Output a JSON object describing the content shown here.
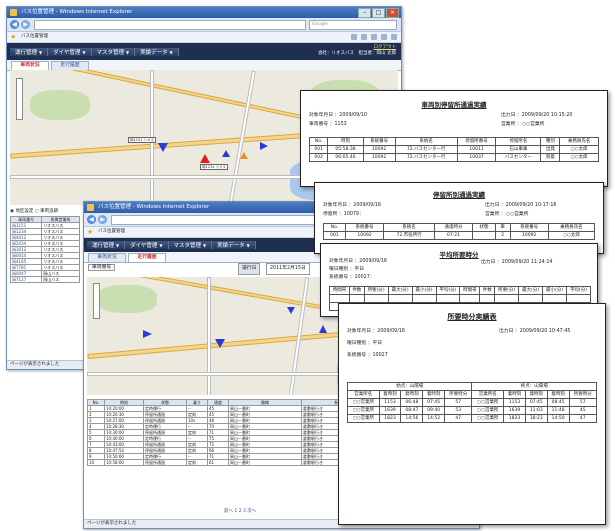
{
  "browser": {
    "title": "バス位置管理 - Windows Internet Explorer",
    "favorite_tab": "バス位置管理",
    "search_placeholder": "Google",
    "status_text": "ページが表示されました",
    "zone_text": "ローカル イントラネット",
    "zoom_text": "100%"
  },
  "app": {
    "menus": [
      "運行管理",
      "ダイヤ管理",
      "マスタ管理",
      "実績データ"
    ],
    "logout": "ログアウト",
    "user_info": "会社：リオスバス　担当者：岡山 太郎"
  },
  "back_window": {
    "tabs": [
      "車両状況",
      "走行履歴"
    ],
    "filter_label": "地区設定",
    "filter_option": "車両追跡",
    "list_headers": [
      "車両番号",
      "所属営業所",
      "所属"
    ],
    "list_rows": [
      [
        "岡1151",
        "リオスバス"
      ],
      [
        "岡1234",
        "リオスバス"
      ],
      [
        "岡4012",
        "リオスバス"
      ],
      [
        "岡2034",
        "リオスバス"
      ],
      [
        "岡3012",
        "リオスバス"
      ],
      [
        "岡0014",
        "リオスバス"
      ],
      [
        "岡4165",
        "リオスバス"
      ],
      [
        "岡7781",
        "リオスバス"
      ],
      [
        "岡0047",
        "岡山バス"
      ],
      [
        "岡7127",
        "岡山バス"
      ]
    ]
  },
  "front_window": {
    "tabs": [
      "車両状況",
      "走行履歴"
    ],
    "vehicle_field": "車両番号",
    "date_label": "運行日",
    "date_value": "2011年2月15日",
    "table_headers": [
      "No.",
      "時刻",
      "状態",
      "乗り",
      "速度",
      "路線",
      "系統"
    ],
    "rows": [
      [
        "1",
        "10:20:00",
        "定時運行",
        "--",
        "45",
        "岡山一番町",
        "倉敷駅行き"
      ],
      [
        "2",
        "10:20:30",
        "停留所通過",
        "定刻",
        "45",
        "岡山一番町",
        "倉敷駅行き"
      ],
      [
        "3",
        "10:27:00",
        "停留所通過",
        "10s",
        "48",
        "岡山一番町",
        "倉敷駅行き"
      ],
      [
        "4",
        "10:28:30",
        "定時運行",
        "--",
        "70",
        "岡山一番町",
        "倉敷駅行き"
      ],
      [
        "5",
        "10:30:00",
        "停留所通過",
        "定刻",
        "71",
        "岡山一番町",
        "倉敷駅行き"
      ],
      [
        "6",
        "10:40:00",
        "定時運行",
        "--",
        "75",
        "岡山一番町",
        "倉敷駅行き"
      ],
      [
        "7",
        "10:43:00",
        "停留所通過",
        "定刻",
        "75",
        "岡山一番町",
        "倉敷駅行き"
      ],
      [
        "8",
        "10:47:54",
        "停留所通過",
        "定刻",
        "66",
        "岡山一番町",
        "倉敷駅行き"
      ],
      [
        "9",
        "10:50:00",
        "定時運行",
        "--",
        "71",
        "岡山一番町",
        "倉敷駅行き"
      ],
      [
        "10",
        "10:58:00",
        "停留所通過",
        "定刻",
        "61",
        "岡山一番町",
        "倉敷駅行き"
      ]
    ],
    "side_notes": [
      "",
      "",
      "",
      "",
      "",
      "県病院前",
      "",
      "角前",
      "",
      "某ヶ瀬"
    ],
    "pagination": "前へ  1  2  3  次へ"
  },
  "reports": [
    {
      "title": "車両別停留所通過実績",
      "meta": [
        "対象年月日 ：2009/09/10",
        "車両番号 ：1153"
      ],
      "meta_right": [
        "出力日 ：2009/09/20 10:15:20",
        "営業所 ：○○営業所"
      ],
      "headers": [
        "No.",
        "時刻",
        "系統番号",
        "系統名",
        "停留所番号",
        "停留所名",
        "種別",
        "乗務員氏名"
      ],
      "rows": [
        [
          "001",
          "05:58:38",
          "10092",
          "72.バスセンター行",
          "10011",
          "石山車庫",
          "出発",
          "○○太郎"
        ],
        [
          "002",
          "06:05:46",
          "10092",
          "72.バスセンター行",
          "10037",
          "バスセンター",
          "到着",
          "○○太郎"
        ]
      ]
    },
    {
      "title": "停留所別通過実績",
      "meta": [
        "対象年月日 ：2009/09/16",
        "停留所 ：10079："
      ],
      "meta_right": [
        "出力日 ：2009/09/20 10:17:16",
        "営業所 ：○○営業所"
      ],
      "headers": [
        "No.",
        "系統番号",
        "系統名",
        "通過時分",
        "状態",
        "車",
        "系統番号",
        "乗務員氏名"
      ],
      "rows": [
        [
          "001",
          "10092",
          "72.市役所行",
          "07:21",
          "",
          "2",
          "10092",
          "○○太郎"
        ]
      ]
    },
    {
      "title": "平均所要時分",
      "meta": [
        "対象年月日 ：2009/09/16",
        "曜日種別 ：平日",
        "系統番号 ：10027："
      ],
      "meta_right": [
        "出力日 ：2009/09/20 11:24:14"
      ],
      "headers": [
        "時間帯",
        "件数",
        "所要(分)",
        "最大(分)",
        "最小(分)",
        "平均(分)",
        "時間帯",
        "件数",
        "所要(分)",
        "最大(分)",
        "最小(分)",
        "平均(分)"
      ]
    },
    {
      "title": "所要時分実績表",
      "meta": [
        "対象年月日 ：2009/09/16",
        "曜日種別 ：平日",
        "系統番号 ：10027"
      ],
      "meta_right": [
        "出力日 ：2009/09/20 10:47:45"
      ],
      "group_headers": [
        "始点：山陽場",
        "終点：山陽場"
      ],
      "headers": [
        "営業所名",
        "着時刻",
        "発時刻",
        "着時刻",
        "所要時分",
        "営業所名",
        "着時刻",
        "発時刻",
        "着時刻",
        "所要時分"
      ],
      "rows": [
        [
          "○○営業所",
          "1153",
          "06:48",
          "07:45",
          "57",
          "○○営業所",
          "1153",
          "07:45",
          "08:45",
          "57"
        ],
        [
          "○○営業所",
          "1639",
          "08:47",
          "09:40",
          "53",
          "○○営業所",
          "1639",
          "11:03",
          "11:48",
          "45"
        ],
        [
          "○○営業所",
          "1823",
          "14:56",
          "14:52",
          "47",
          "○○営業所",
          "1823",
          "18:23",
          "14:50",
          "47"
        ]
      ]
    }
  ],
  "colors": {
    "menubar": "#1f2f4f",
    "titlebar": "#2d5da8",
    "bus_marker": "#2a39d8",
    "alert_marker": "#e02020",
    "warn_marker": "#f08a24"
  }
}
